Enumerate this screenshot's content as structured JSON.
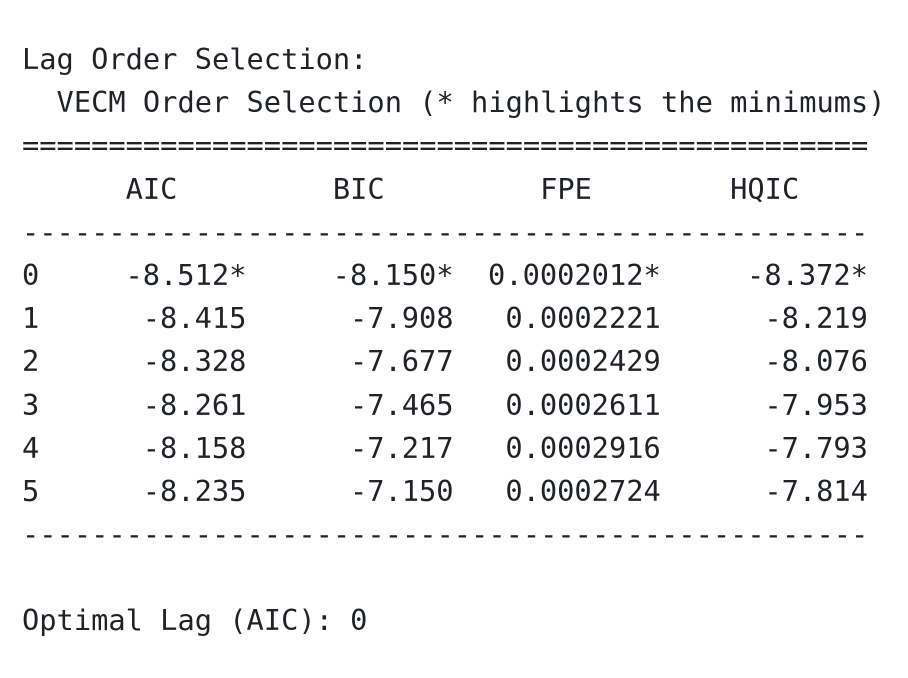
{
  "heading": "Lag Order Selection:",
  "table": {
    "title": "  VECM Order Selection (* highlights the minimums)",
    "rule_double": "=================================================",
    "rule_single": "-------------------------------------------------",
    "columns": [
      "",
      "AIC",
      "BIC",
      "FPE",
      "HQIC"
    ],
    "header_line": "      AIC         BIC         FPE        HQIC  ",
    "rows": [
      {
        "lag": "0",
        "aic": "-8.512*",
        "bic": "-8.150*",
        "fpe": "0.0002012*",
        "hqic": "-8.372*"
      },
      {
        "lag": "1",
        "aic": "-8.415",
        "bic": "-7.908",
        "fpe": "0.0002221",
        "hqic": "-8.219"
      },
      {
        "lag": "2",
        "aic": "-8.328",
        "bic": "-7.677",
        "fpe": "0.0002429",
        "hqic": "-8.076"
      },
      {
        "lag": "3",
        "aic": "-8.261",
        "bic": "-7.465",
        "fpe": "0.0002611",
        "hqic": "-7.953"
      },
      {
        "lag": "4",
        "aic": "-8.158",
        "bic": "-7.217",
        "fpe": "0.0002916",
        "hqic": "-7.793"
      },
      {
        "lag": "5",
        "aic": "-8.235",
        "bic": "-7.150",
        "fpe": "0.0002724",
        "hqic": "-7.814"
      }
    ]
  },
  "optimal": "Optimal Lag (AIC): 0"
}
